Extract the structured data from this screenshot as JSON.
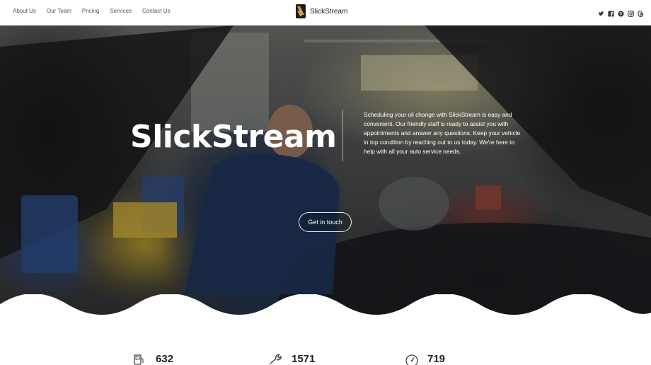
{
  "nav": {
    "items": [
      {
        "label": "About Us"
      },
      {
        "label": "Our Team"
      },
      {
        "label": "Pricing"
      },
      {
        "label": "Services"
      },
      {
        "label": "Contact Us"
      }
    ]
  },
  "brand": {
    "name": "SlickStream"
  },
  "socials": [
    {
      "icon": "twitter-icon"
    },
    {
      "icon": "facebook-icon"
    },
    {
      "icon": "pinterest-icon"
    },
    {
      "icon": "instagram-icon"
    },
    {
      "icon": "threads-icon"
    }
  ],
  "hero": {
    "title": "SlickStream",
    "text": "Scheduling your oil change with SlickStream is easy and convenient. Our friendly staff is ready to assist you with appointments and answer any questions. Keep your vehicle in top condition by reaching out to us today. We're here to help with all your auto service needs.",
    "cta_label": "Get in touch"
  },
  "stats": [
    {
      "icon": "fuel-pump-icon",
      "value": "632"
    },
    {
      "icon": "wrench-icon",
      "value": "1571"
    },
    {
      "icon": "gauge-icon",
      "value": "719"
    }
  ],
  "colors": {
    "accent": "#ffffff",
    "text": "#222222",
    "nav": "#555555"
  }
}
